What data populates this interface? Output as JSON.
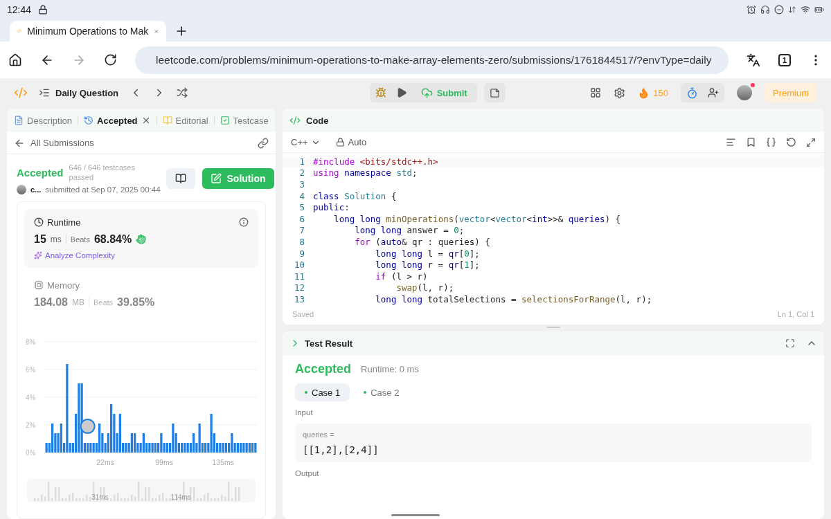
{
  "status_bar": {
    "time": "12:44"
  },
  "browser": {
    "tab_title": "Minimum Operations to Mak",
    "url": "leetcode.com/problems/minimum-operations-to-make-array-elements-zero/submissions/1761844517/?envType=daily",
    "tab_count": "1",
    "forward_disabled": true
  },
  "toolbar": {
    "daily": "Daily Question",
    "submit": "Submit",
    "streak": "150",
    "premium": "Premium",
    "notification": true
  },
  "left_tabs": [
    {
      "label": "Description",
      "selected": false,
      "closable": false
    },
    {
      "label": "Accepted",
      "selected": true,
      "closable": true
    },
    {
      "label": "Editorial",
      "selected": false,
      "closable": false
    },
    {
      "label": "Testcase",
      "selected": false,
      "closable": false
    }
  ],
  "submission": {
    "back_label": "All Submissions",
    "status": "Accepted",
    "testcases": "646 / 646 testcases passed",
    "user": "c...",
    "submitted": "submitted at Sep 07, 2025 00:44",
    "solution_button": "Solution"
  },
  "metrics": [
    {
      "kind": "runtime",
      "title": "Runtime",
      "value": "15",
      "unit": "ms",
      "beats_label": "Beats",
      "beats": "68.84%",
      "selected": true,
      "action": "Analyze Complexity"
    },
    {
      "kind": "memory",
      "title": "Memory",
      "value": "184.08",
      "unit": "MB",
      "beats_label": "Beats",
      "beats": "39.85%",
      "selected": false
    }
  ],
  "chart_data": {
    "type": "bar",
    "grid": true,
    "ylim": [
      0,
      8
    ],
    "yticks": [
      {
        "value": 0,
        "label": "0%"
      },
      {
        "value": 2,
        "label": "2%"
      },
      {
        "value": 4,
        "label": "4%"
      },
      {
        "value": 6,
        "label": "6%"
      },
      {
        "value": 8,
        "label": "8%"
      }
    ],
    "categories": [
      null,
      null,
      null,
      null,
      null,
      null,
      null,
      null,
      null,
      null,
      null,
      null,
      null,
      null,
      null,
      null,
      null,
      null,
      null,
      null,
      "22ms",
      null,
      null,
      null,
      null,
      null,
      null,
      null,
      null,
      null,
      null,
      null,
      null,
      null,
      null,
      null,
      null,
      null,
      null,
      null,
      "99ms",
      null,
      null,
      null,
      null,
      null,
      null,
      null,
      null,
      null,
      null,
      null,
      null,
      null,
      null,
      null,
      null,
      null,
      null,
      null,
      "135ms",
      null,
      null,
      null,
      null,
      null,
      null,
      null,
      null,
      null,
      null,
      null
    ],
    "values": [
      0.7,
      0.7,
      2.1,
      1.4,
      1.4,
      2.1,
      0.7,
      6.4,
      0.7,
      0.7,
      2.8,
      5.0,
      5.0,
      0.7,
      0.7,
      0.7,
      0.7,
      0.7,
      2.1,
      1.4,
      0.7,
      1.4,
      3.5,
      2.8,
      1.4,
      2.8,
      0.7,
      0.7,
      0.7,
      1.4,
      1.4,
      0.7,
      0.7,
      1.4,
      0.7,
      0.7,
      0.7,
      0.7,
      0.7,
      1.4,
      0.7,
      0.7,
      0.7,
      2.1,
      1.4,
      0.7,
      0.7,
      0.7,
      0.7,
      0.7,
      1.4,
      0.7,
      2.1,
      0.7,
      0.7,
      0.7,
      2.8,
      1.4,
      0.7,
      0.7,
      0.7,
      0.7,
      0.7,
      1.4,
      0.7,
      0.7,
      0.7,
      0.7,
      0.7,
      0.7,
      0.7,
      0.7
    ]
  },
  "overview": {
    "labels": [
      "31ms",
      "114ms"
    ]
  },
  "code": {
    "title": "Code",
    "language": "C++",
    "mode": "Auto",
    "lines": [
      {
        "number": "1",
        "tokens": [
          {
            "kind": "pre",
            "text": "#include"
          },
          {
            "kind": "str",
            "text": " <bits/stdc++.h>"
          }
        ]
      },
      {
        "number": "2",
        "tokens": [
          {
            "kind": "ctrl",
            "text": "using"
          },
          {
            "kind": "kw",
            "text": " namespace"
          },
          {
            "kind": "type",
            "text": " std"
          },
          {
            "kind": "plain",
            "text": ";"
          }
        ]
      },
      {
        "number": "3"
      },
      {
        "number": "4",
        "tokens": [
          {
            "kind": "kw",
            "text": "class"
          },
          {
            "kind": "type",
            "text": " Solution"
          },
          {
            "kind": "plain",
            "text": " {"
          }
        ]
      },
      {
        "number": "5",
        "tokens": [
          {
            "kind": "kw",
            "text": "public"
          },
          {
            "kind": "plain",
            "text": ":"
          }
        ]
      },
      {
        "number": "6",
        "tokens": [
          {
            "kind": "kw",
            "text": "    long long"
          },
          {
            "kind": "fn",
            "text": " minOperations"
          },
          {
            "kind": "plain",
            "text": "("
          },
          {
            "kind": "type",
            "text": "vector"
          },
          {
            "kind": "plain",
            "text": "<"
          },
          {
            "kind": "type",
            "text": "vector"
          },
          {
            "kind": "plain",
            "text": "<"
          },
          {
            "kind": "kw",
            "text": "int"
          },
          {
            "kind": "plain",
            "text": ">>& "
          },
          {
            "kind": "kw",
            "text": "queries"
          },
          {
            "kind": "plain",
            "text": ") {"
          }
        ]
      },
      {
        "number": "7",
        "tokens": [
          {
            "kind": "kw",
            "text": "        long long"
          },
          {
            "kind": "plain",
            "text": " answer = "
          },
          {
            "kind": "num",
            "text": "0"
          },
          {
            "kind": "plain",
            "text": ";"
          }
        ]
      },
      {
        "number": "8",
        "tokens": [
          {
            "kind": "ctrl",
            "text": "        for"
          },
          {
            "kind": "plain",
            "text": " ("
          },
          {
            "kind": "kw",
            "text": "auto"
          },
          {
            "kind": "plain",
            "text": "& qr : queries) {"
          }
        ]
      },
      {
        "number": "9",
        "tokens": [
          {
            "kind": "kw",
            "text": "            long long"
          },
          {
            "kind": "plain",
            "text": " l = "
          },
          {
            "kind": "kw",
            "text": "qr"
          },
          {
            "kind": "plain",
            "text": "["
          },
          {
            "kind": "num",
            "text": "0"
          },
          {
            "kind": "plain",
            "text": "];"
          }
        ]
      },
      {
        "number": "10",
        "tokens": [
          {
            "kind": "kw",
            "text": "            long long"
          },
          {
            "kind": "plain",
            "text": " r = "
          },
          {
            "kind": "kw",
            "text": "qr"
          },
          {
            "kind": "plain",
            "text": "["
          },
          {
            "kind": "num",
            "text": "1"
          },
          {
            "kind": "plain",
            "text": "];"
          }
        ]
      },
      {
        "number": "11",
        "tokens": [
          {
            "kind": "ctrl",
            "text": "            if"
          },
          {
            "kind": "plain",
            "text": " (l > r)"
          }
        ]
      },
      {
        "number": "12",
        "tokens": [
          {
            "kind": "fn",
            "text": "                swap"
          },
          {
            "kind": "plain",
            "text": "(l, r);"
          }
        ]
      },
      {
        "number": "13",
        "tokens": [
          {
            "kind": "kw",
            "text": "            long long"
          },
          {
            "kind": "plain",
            "text": " totalSelections = "
          },
          {
            "kind": "fn",
            "text": "selectionsForRange"
          },
          {
            "kind": "plain",
            "text": "(l, r);"
          }
        ]
      }
    ],
    "saved": "Saved",
    "cursor": "Ln 1, Col 1"
  },
  "test_result": {
    "title": "Test Result",
    "status": "Accepted",
    "runtime": "Runtime: 0 ms",
    "cases": [
      {
        "label": "Case 1",
        "selected": true
      },
      {
        "label": "Case 2",
        "selected": false
      }
    ],
    "input_label": "Input",
    "param": "queries =",
    "value": "[[1,2],[2,4]]",
    "output_label": "Output"
  }
}
